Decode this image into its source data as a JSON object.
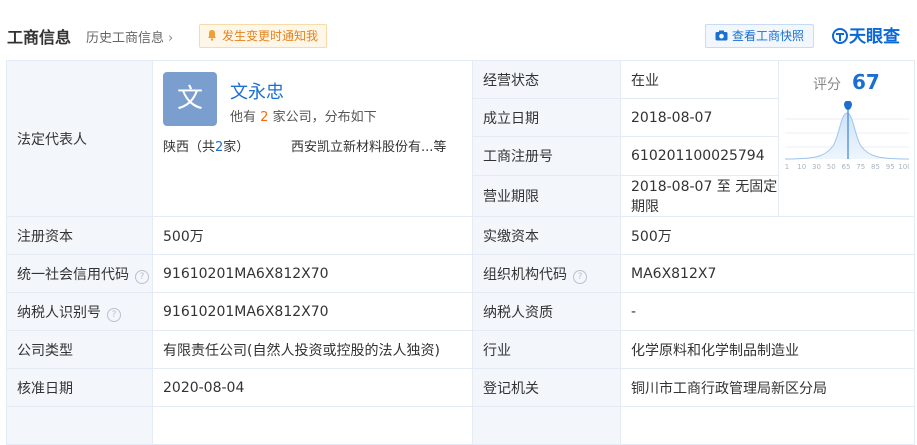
{
  "header": {
    "title": "工商信息",
    "history_link": "历史工商信息",
    "notice_label": "发生变更时通知我",
    "snapshot_label": "查看工商快照",
    "logo_text": "天眼查",
    "accent_color": "#1a6fd0"
  },
  "legal_rep": {
    "label": "法定代表人",
    "avatar_char": "文",
    "name": "文永忠",
    "desc_prefix": "他有",
    "count": "2",
    "desc_suffix": "家公司，分布如下",
    "region": "陕西（共",
    "region_count": "2",
    "region_suffix": "家）",
    "company": "西安凯立新材料股份有...等"
  },
  "status": {
    "label": "经营状态",
    "value": "在业"
  },
  "founded": {
    "label": "成立日期",
    "value": "2018-08-07"
  },
  "reg_no": {
    "label": "工商注册号",
    "value": "610201100025794"
  },
  "term": {
    "label": "营业期限",
    "value": "2018-08-07  至  无固定期限"
  },
  "score": {
    "label": "评分",
    "value": "67",
    "ticks": [
      "1",
      "10",
      "30",
      "50",
      "65",
      "75",
      "85",
      "95",
      "100"
    ]
  },
  "rows": [
    {
      "l1": "注册资本",
      "v1": "500万",
      "l2": "实缴资本",
      "v2": "500万"
    },
    {
      "l1": "统一社会信用代码",
      "v1": "91610201MA6X812X70",
      "l2": "组织机构代码",
      "v2": "MA6X812X7"
    },
    {
      "l1": "纳税人识别号",
      "v1": "91610201MA6X812X70",
      "l2": "纳税人资质",
      "v2": "-"
    },
    {
      "l1": "公司类型",
      "v1": "有限责任公司(自然人投资或控股的法人独资)",
      "l2": "行业",
      "v2": "化学原料和化学制品制造业"
    },
    {
      "l1": "核准日期",
      "v1": "2020-08-04",
      "l2": "登记机关",
      "v2": "铜川市工商行政管理局新区分局"
    }
  ]
}
